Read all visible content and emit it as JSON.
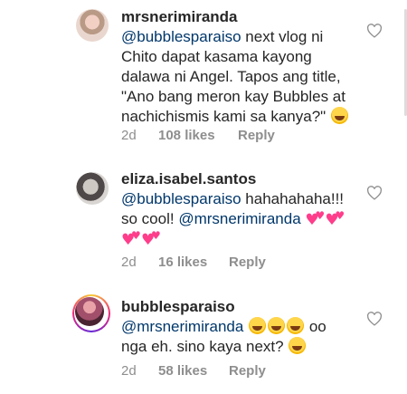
{
  "comments": [
    {
      "username": "mrsnerimiranda",
      "mention": "@bubblesparaiso",
      "text": " next vlog ni Chito dapat kasama kayong dalawa ni Angel. Tapos ang title, \"Ano bang meron kay Bubbles at nachichismis kami sa kanya?\"",
      "emoji": "laughing-emoji",
      "time": "2d",
      "likes": "108 likes",
      "reply": "Reply"
    },
    {
      "username": "eliza.isabel.santos",
      "mention": "@bubblesparaiso",
      "text": " hahahahaha!!! so cool! ",
      "mention2": "@mrsnerimiranda",
      "emoji": "two-hearts-emoji",
      "time": "2d",
      "likes": "16 likes",
      "reply": "Reply"
    },
    {
      "username": "bubblesparaiso",
      "mention": "@mrsnerimiranda",
      "text": " oo nga eh. sino kaya next?",
      "emoji": "laughing-emoji",
      "time": "2d",
      "likes": "58 likes",
      "reply": "Reply"
    }
  ],
  "colors": {
    "mention": "#00376b",
    "meta": "#8e8e8e",
    "text": "#262626"
  }
}
